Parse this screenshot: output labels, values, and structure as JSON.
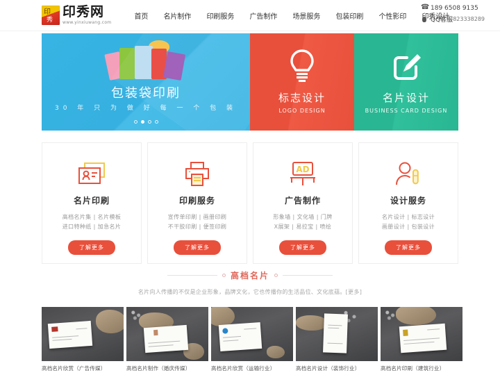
{
  "header": {
    "logo": {
      "cn": "印秀网",
      "url": "www.yinxiuwang.com",
      "mark_top": "印",
      "mark_bottom": "秀"
    },
    "nav": [
      {
        "label": "首页"
      },
      {
        "label": "名片制作"
      },
      {
        "label": "印刷服务"
      },
      {
        "label": "广告制作"
      },
      {
        "label": "场景服务"
      },
      {
        "label": "包装印刷"
      },
      {
        "label": "个性影印"
      },
      {
        "label": "印秀设计"
      }
    ],
    "contact": {
      "phone_icon": "phone-icon",
      "phone": "189 6508 9135",
      "qq_icon": "qq-icon",
      "qq_label": "QQ客服",
      "qq_number": "823338289"
    }
  },
  "banner": {
    "main": {
      "title": "包装袋印刷",
      "subtitle": "30 年 只 为 做 好 每 一 个 包 装",
      "bg_color": "#37b4e3",
      "dots": 4,
      "active_dot": 1
    },
    "panels": [
      {
        "cn": "标志设计",
        "en": "LOGO DESIGN",
        "icon": "lightbulb-icon",
        "bg_color": "#e8503c"
      },
      {
        "cn": "名片设计",
        "en": "BUSINESS CARD DESIGN",
        "icon": "edit-square-icon",
        "bg_color": "#28b792"
      }
    ]
  },
  "cards": [
    {
      "icon": "id-card-icon",
      "title": "名片印刷",
      "links": [
        "高档名片集  |  名片模板",
        "进口特种纸  |  加急名片"
      ],
      "button": "了解更多"
    },
    {
      "icon": "printer-icon",
      "title": "印刷服务",
      "links": [
        "宣传单印刷  |  画册印刷",
        "不干胶印刷  |  便签印刷"
      ],
      "button": "了解更多"
    },
    {
      "icon": "ad-board-icon",
      "title": "广告制作",
      "links": [
        "形象墙 | 文化墙 | 门牌",
        "X展架 | 易拉宝 | 喷绘"
      ],
      "button": "了解更多"
    },
    {
      "icon": "person-pencil-icon",
      "title": "设计服务",
      "links": [
        "名片设计  |  标志设计",
        "画册设计  |  包装设计"
      ],
      "button": "了解更多"
    }
  ],
  "section": {
    "title": "高档名片",
    "description": "名片向人传播的不仅是企业形象，品牌文化，它也传播你的生活品位、文化底蕴。",
    "more": "[更多]",
    "accent_color": "#e0675a"
  },
  "gallery": [
    {
      "caption": "高档名片欣赏（广告传媒）"
    },
    {
      "caption": "高档名片制作（婚庆传媒）"
    },
    {
      "caption": "高档名片欣赏（运输行业）"
    },
    {
      "caption": "高档名片设计（装饰行业）"
    },
    {
      "caption": "高档名片印刷（建筑行业）"
    }
  ]
}
